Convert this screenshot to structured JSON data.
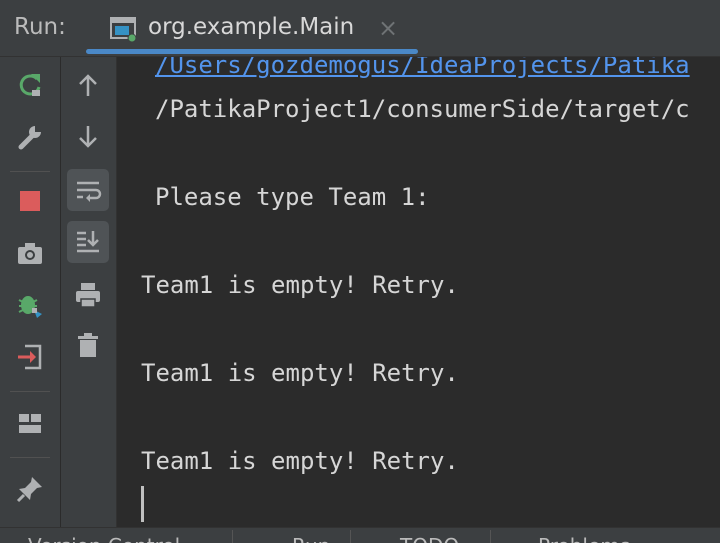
{
  "header": {
    "run_label": "Run:",
    "tab_title": "org.example.Main",
    "tab_close": "×",
    "tab_icon": "console-window-icon",
    "accent": "#4a88c7"
  },
  "toolbar_left": [
    {
      "name": "rerun-icon",
      "color": "#59a869"
    },
    {
      "name": "wrench-icon"
    },
    {
      "name": "stop-icon",
      "color": "#db5c5c"
    },
    {
      "name": "camera-icon"
    },
    {
      "name": "bug-icon",
      "color": "#59a869"
    },
    {
      "name": "exit-icon",
      "color": "#db5c5c"
    },
    {
      "name": "layout-icon"
    },
    {
      "name": "pin-icon"
    }
  ],
  "toolbar_right": [
    {
      "name": "arrow-up-icon"
    },
    {
      "name": "arrow-down-icon"
    },
    {
      "name": "soft-wrap-icon",
      "active": true
    },
    {
      "name": "scroll-to-end-icon",
      "active": true
    },
    {
      "name": "printer-icon"
    },
    {
      "name": "trash-icon"
    }
  ],
  "console": {
    "lines": [
      "/Users/gozdemogus/IdeaProjects/Patika",
      "/PatikaProject1/consumerSide/target/c",
      "Please type Team 1:",
      "Team1 is empty! Retry.",
      "Team1 is empty! Retry.",
      "Team1 is empty! Retry."
    ],
    "link_color": "#5394ec",
    "text_color": "#d6d6d6"
  },
  "bottom_bar": {
    "items": [
      "Version Control",
      "Run",
      "TODO",
      "Problems"
    ]
  }
}
